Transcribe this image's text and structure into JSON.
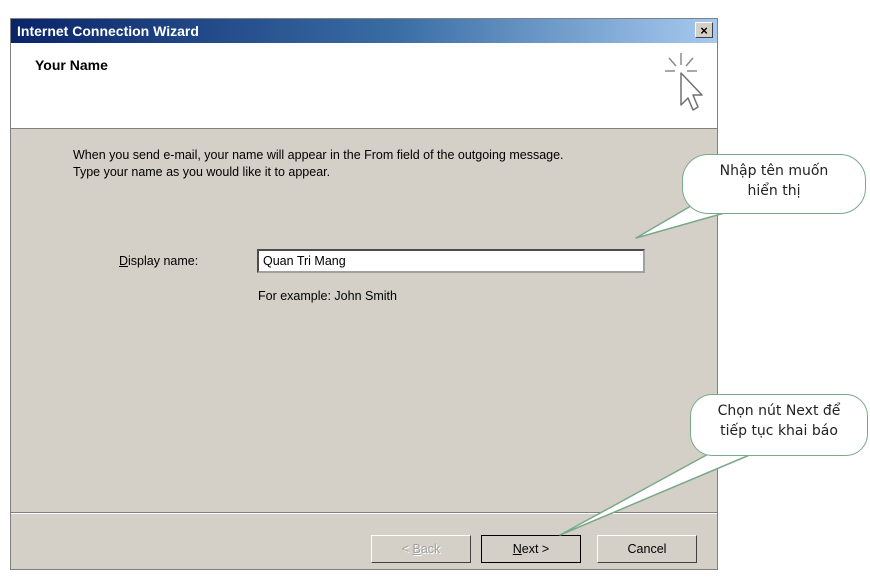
{
  "window": {
    "title": "Internet Connection Wizard",
    "close_label": "×"
  },
  "header": {
    "page_title": "Your Name",
    "icon": "wizard-cursor-icon"
  },
  "body": {
    "instruction_line1": "When you send e-mail, your name will appear in the From field of the outgoing message.",
    "instruction_line2": "Type your name as you would like it to appear."
  },
  "form": {
    "display_name_label_prefix": "D",
    "display_name_label_rest": "isplay name:",
    "display_name_value": "Quan Tri Mang",
    "example_text": "For example: John Smith"
  },
  "buttons": {
    "back_prefix": "< ",
    "back_underlined": "B",
    "back_rest": "ack",
    "next_underlined": "N",
    "next_rest": "ext >",
    "cancel": "Cancel"
  },
  "callouts": {
    "name_hint_line1": "Nhập tên muốn",
    "name_hint_line2": "hiển thị",
    "next_hint_line1": "Chọn nút Next để",
    "next_hint_line2": "tiếp tục khai báo"
  },
  "colors": {
    "titlebar_start": "#0a246a",
    "dialog_face": "#d4d0c8",
    "callout_border": "#7aa88a"
  }
}
